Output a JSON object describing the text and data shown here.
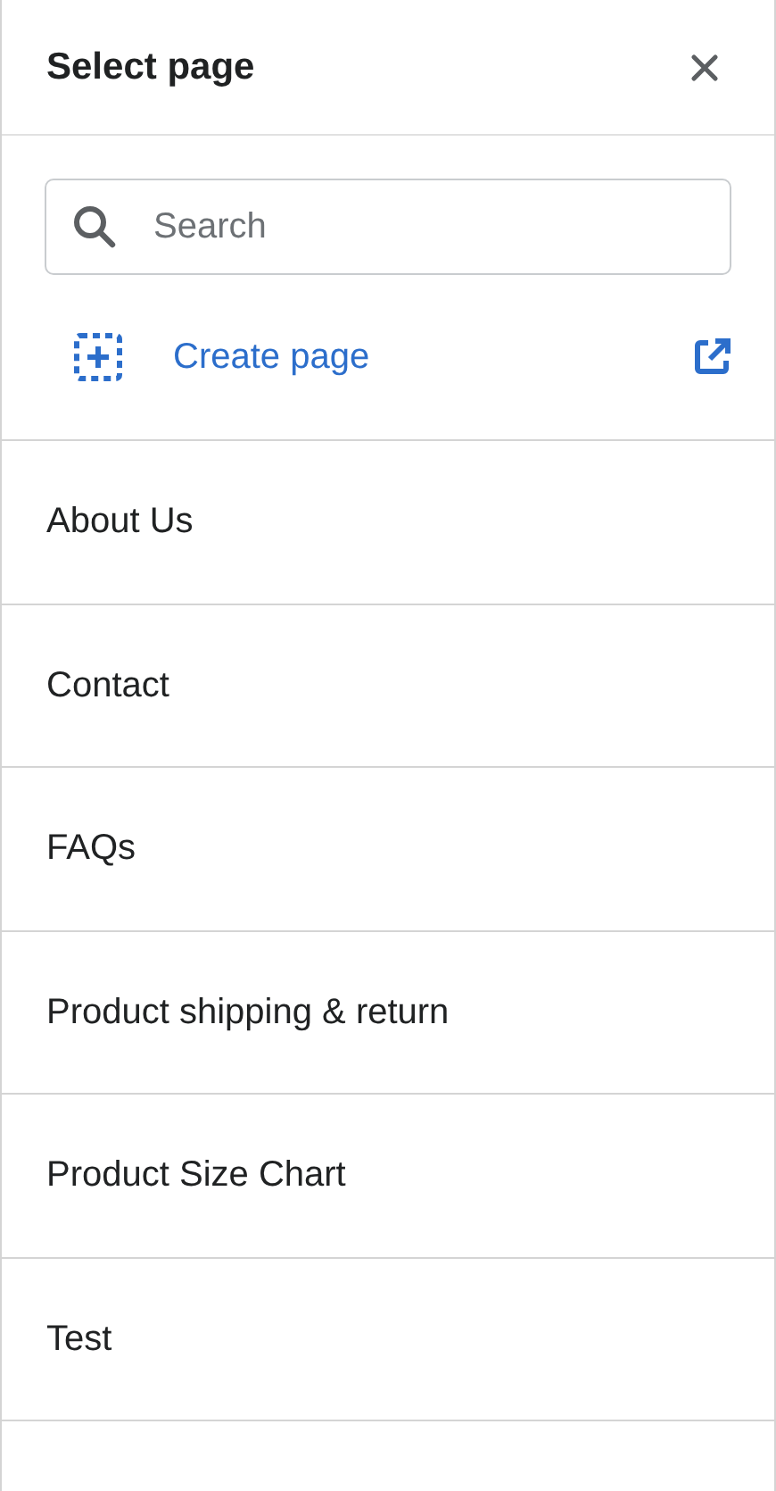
{
  "header": {
    "title": "Select page"
  },
  "search": {
    "placeholder": "Search"
  },
  "create_link": {
    "label": "Create page"
  },
  "pages": [
    {
      "label": "About Us"
    },
    {
      "label": "Contact"
    },
    {
      "label": "FAQs"
    },
    {
      "label": "Product shipping & return"
    },
    {
      "label": "Product Size Chart"
    },
    {
      "label": "Test"
    }
  ]
}
